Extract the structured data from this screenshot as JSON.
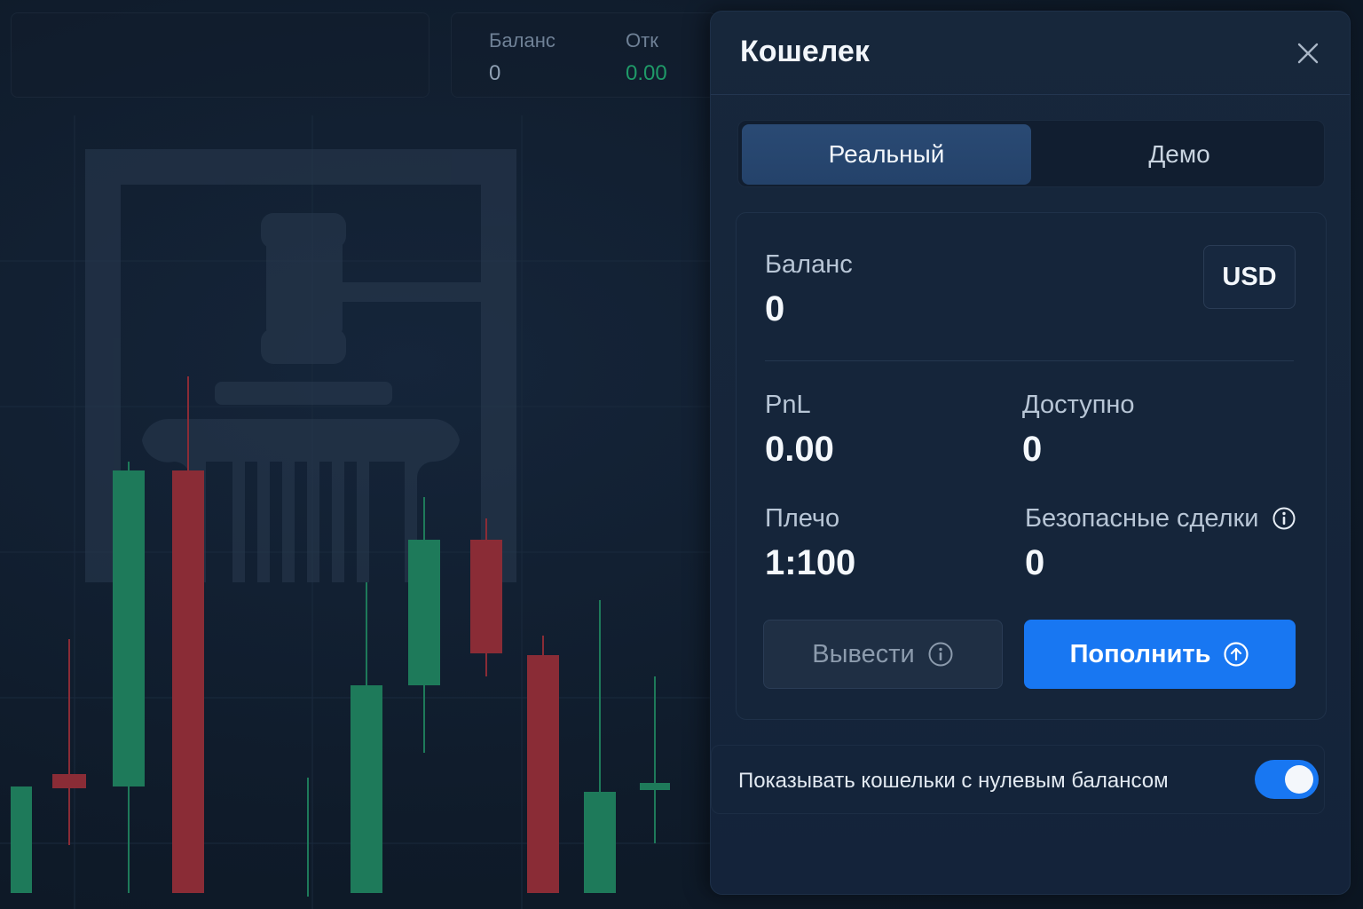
{
  "topbar": {
    "balance_label": "Баланс",
    "balance_value": "0",
    "open_label": "Отк",
    "open_value": "0.00"
  },
  "chart_data": {
    "type": "candlestick",
    "candles": [
      {
        "o": 886,
        "c": 1006,
        "h": 886,
        "l": 1006,
        "dir": "up"
      },
      {
        "o": 872,
        "c": 888,
        "h": 720,
        "l": 952,
        "dir": "down"
      },
      {
        "o": 886,
        "c": 530,
        "h": 520,
        "l": 1006,
        "dir": "up"
      },
      {
        "o": 530,
        "c": 1006,
        "h": 424,
        "l": 1006,
        "dir": "down"
      },
      {
        "o": 1006,
        "c": 1006,
        "h": 876,
        "l": 1006,
        "dir": "up"
      },
      {
        "o": 1006,
        "c": 772,
        "h": 656,
        "l": 1006,
        "dir": "up"
      },
      {
        "o": 772,
        "c": 608,
        "h": 560,
        "l": 848,
        "dir": "up"
      },
      {
        "o": 608,
        "c": 736,
        "h": 584,
        "l": 762,
        "dir": "down"
      },
      {
        "o": 738,
        "c": 1006,
        "h": 716,
        "l": 1006,
        "dir": "down"
      },
      {
        "o": 1006,
        "c": 892,
        "h": 676,
        "l": 1006,
        "dir": "up"
      },
      {
        "o": 882,
        "c": 890,
        "h": 762,
        "l": 950,
        "dir": "up"
      }
    ]
  },
  "modal": {
    "title": "Кошелек",
    "tabs": [
      {
        "label": "Реальный",
        "active": true
      },
      {
        "label": "Демо",
        "active": false
      }
    ],
    "balance_label": "Баланс",
    "balance_value": "0",
    "currency": "USD",
    "pnl_label": "PnL",
    "pnl_value": "0.00",
    "available_label": "Доступно",
    "available_value": "0",
    "leverage_label": "Плечо",
    "leverage_value": "1:100",
    "safe_trades_label": "Безопасные сделки",
    "safe_trades_value": "0",
    "withdraw_label": "Вывести",
    "deposit_label": "Пополнить",
    "show_zero_label": "Показывать кошельки с нулевым балансом",
    "show_zero_enabled": true
  },
  "colors": {
    "up": "#1e7a5a",
    "down": "#8a2c36",
    "accent": "#1877f2"
  }
}
